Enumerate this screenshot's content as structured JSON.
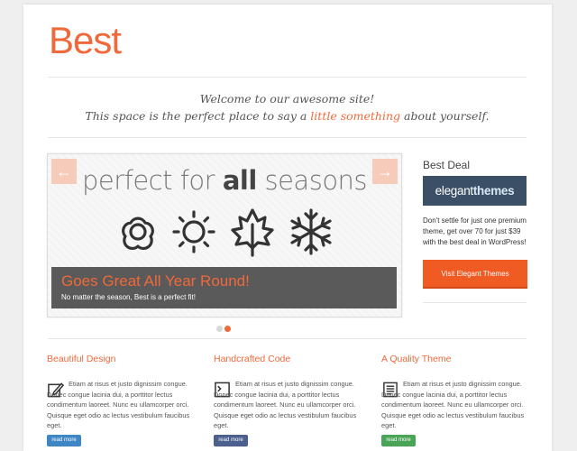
{
  "header": {
    "logo": "Best"
  },
  "welcome": {
    "line1": "Welcome to our awesome site!",
    "line2_pre": "This space is the perfect place to say a ",
    "line2_highlight": "little something",
    "line2_post": " about yourself."
  },
  "slider": {
    "title_pre": "perfect for ",
    "title_bold": "all",
    "title_post": " seasons",
    "prev_label": "←",
    "next_label": "→",
    "icons": [
      "flower-icon",
      "sun-icon",
      "leaf-icon",
      "snowflake-icon"
    ],
    "caption_heading": "Goes Great All Year Round!",
    "caption_sub": "No matter the season, Best is a perfect fit!",
    "active_dot": 2,
    "dot_count": 2
  },
  "best_deal": {
    "title": "Best Deal",
    "banner_pre": "elegant",
    "banner_post": "themes",
    "text": "Don't settle for just one premium theme, get over 70 for just $39 with the best deal in WordPress!",
    "button": "Visit Elegant Themes"
  },
  "columns": [
    {
      "title": "Beautiful Design",
      "icon": "edit-icon",
      "text": "Etiam at risus et justo dignissim congue. Donec congue lacinia dui, a porttitor lectus condimentum laoreet. Nunc eu ullamcorper orci. Quisque eget odio ac lectus vestibulum faucibus eget.",
      "button": "read more",
      "button_color": "#3f86c4"
    },
    {
      "title": "Handcrafted Code",
      "icon": "terminal-icon",
      "text": "Etiam at risus et justo dignissim congue. Donec congue lacinia dui, a porttitor lectus condimentum laoreet. Nunc eu ullamcorper orci. Quisque eget odio ac lectus vestibulum faucibus eget.",
      "button": "read more",
      "button_color": "#4c5f8e"
    },
    {
      "title": "A Quality Theme",
      "icon": "document-icon",
      "text": "Etiam at risus et justo dignissim congue. Donec congue lacinia dui, a porttitor lectus condimentum laoreet. Nunc eu ullamcorper orci. Quisque eget odio ac lectus vestibulum faucibus eget.",
      "button": "read more",
      "button_color": "#4aa457"
    }
  ],
  "colors": {
    "accent": "#f0693a",
    "button_orange": "#f05a23",
    "banner": "#3b4f66"
  }
}
